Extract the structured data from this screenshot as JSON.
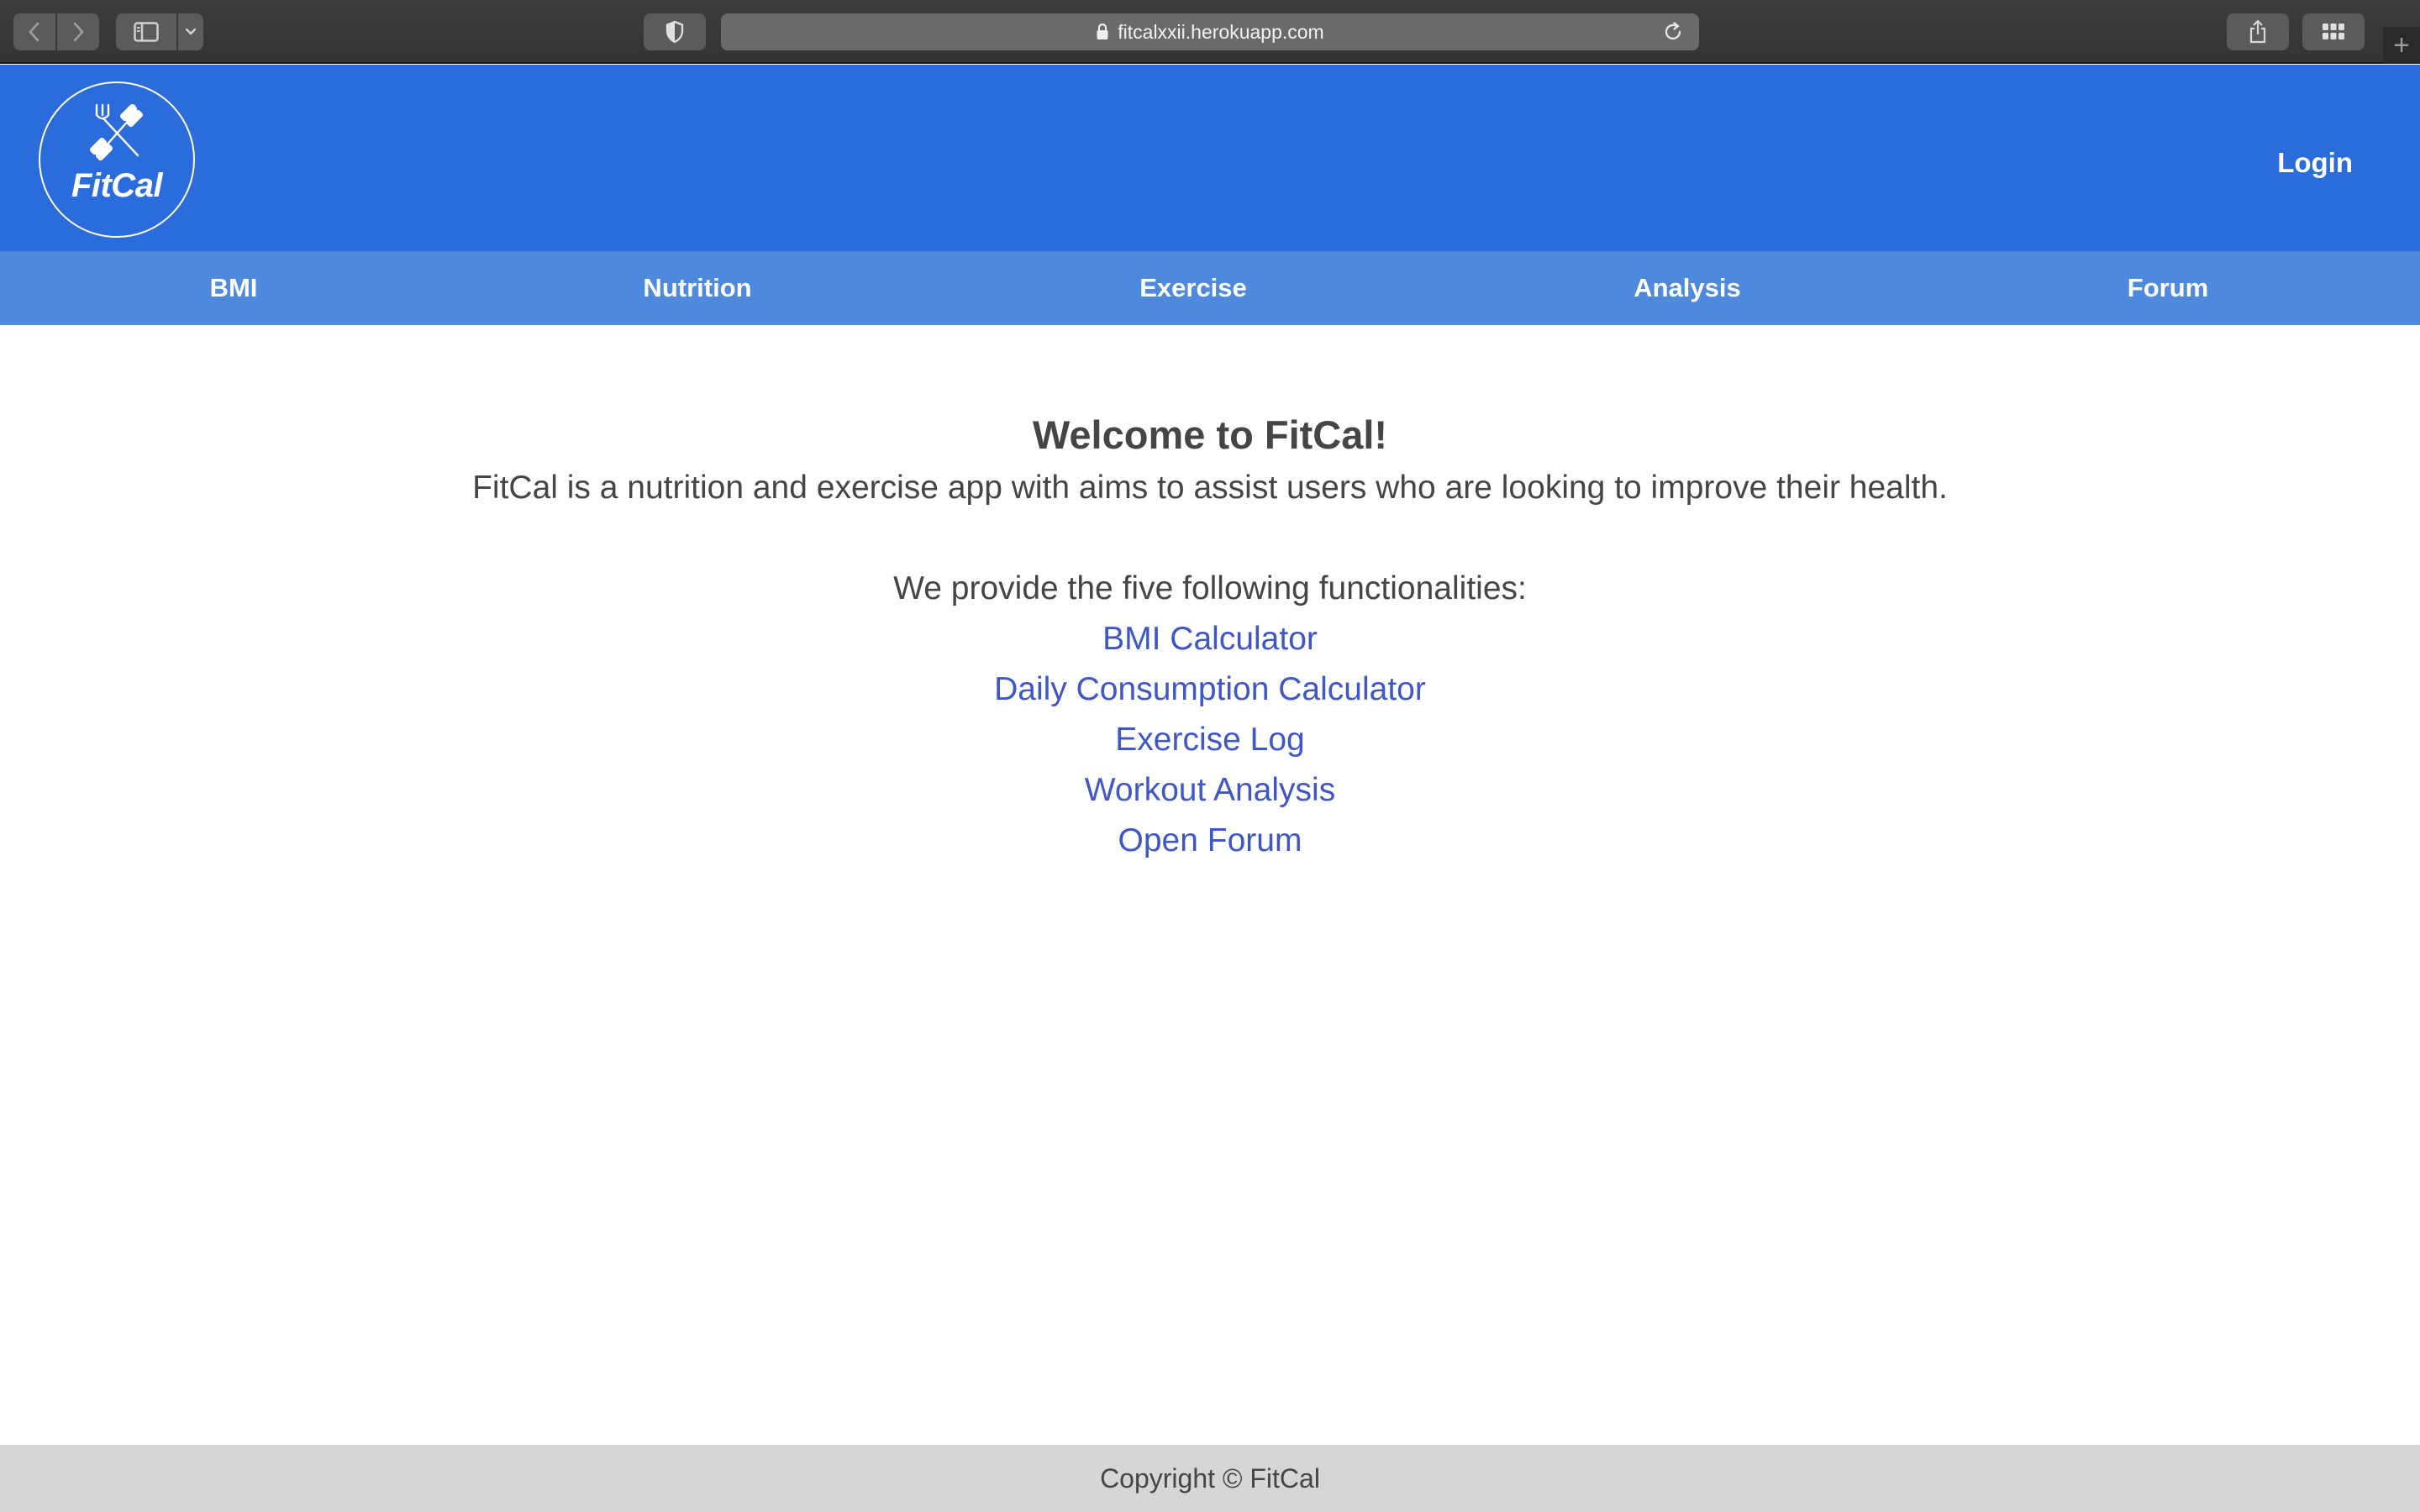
{
  "browser": {
    "url": "fitcalxxii.herokuapp.com",
    "icons": {
      "back": "chevron-left-icon",
      "forward": "chevron-right-icon",
      "sidebar": "sidebar-icon",
      "sidebar_menu": "chevron-down-icon",
      "privacy": "shield-icon",
      "lock": "lock-icon",
      "reload": "reload-icon",
      "share": "share-icon",
      "tab_overview": "grid-icon",
      "new_tab": "plus-icon"
    },
    "new_tab_glyph": "+"
  },
  "header": {
    "logo_text": "FitCal",
    "logo_icon": "dumbbell-fork-icon",
    "login_label": "Login",
    "background_color": "#2a6cdb"
  },
  "nav": {
    "background_color": "#4f89dd",
    "items": [
      {
        "label": "BMI"
      },
      {
        "label": "Nutrition"
      },
      {
        "label": "Exercise"
      },
      {
        "label": "Analysis"
      },
      {
        "label": "Forum"
      }
    ]
  },
  "main": {
    "title": "Welcome to FitCal!",
    "description": "FitCal is a nutrition and exercise app with aims to assist users who are looking to improve their health.",
    "features_intro": "We provide the five following functionalities:",
    "link_color": "#3f56c8",
    "features": [
      {
        "label": "BMI Calculator"
      },
      {
        "label": "Daily Consumption Calculator"
      },
      {
        "label": "Exercise Log"
      },
      {
        "label": "Workout Analysis"
      },
      {
        "label": "Open Forum"
      }
    ]
  },
  "footer": {
    "copyright": "Copyright © FitCal"
  }
}
